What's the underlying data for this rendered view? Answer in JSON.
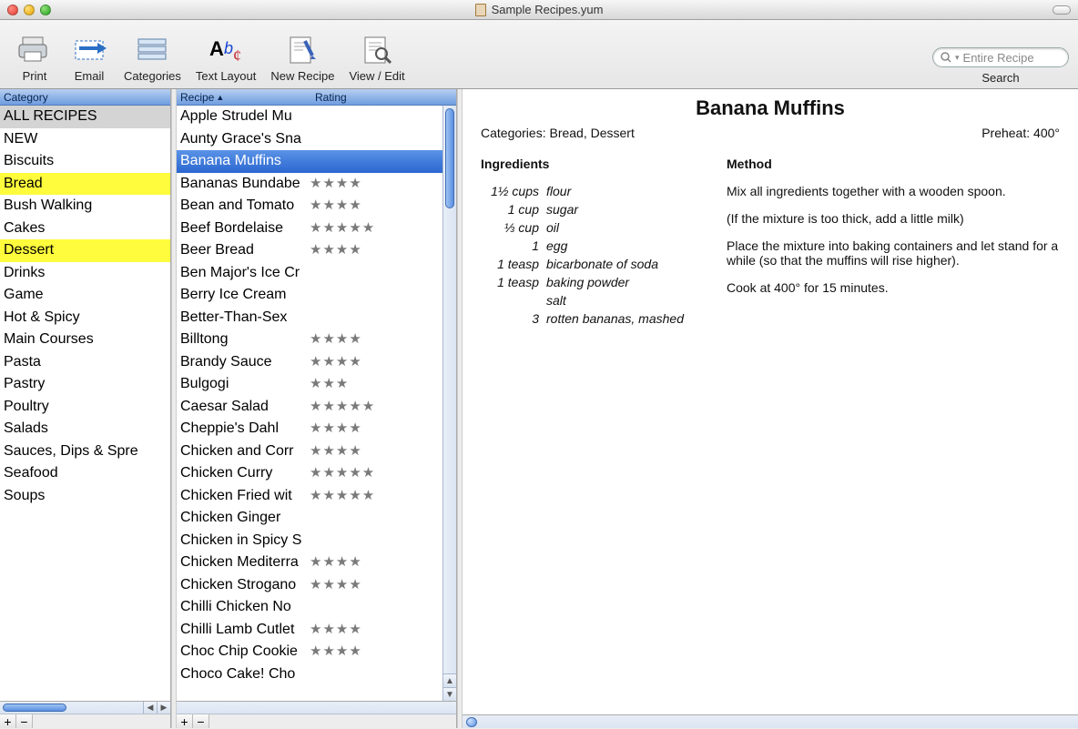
{
  "window": {
    "title": "Sample Recipes.yum"
  },
  "toolbar": {
    "items": [
      {
        "label": "Print"
      },
      {
        "label": "Email"
      },
      {
        "label": "Categories"
      },
      {
        "label": "Text Layout"
      },
      {
        "label": "New Recipe"
      },
      {
        "label": "View / Edit"
      }
    ],
    "search": {
      "placeholder": "Entire Recipe",
      "label": "Search",
      "value": ""
    }
  },
  "category_pane": {
    "header": "Category",
    "items": [
      {
        "label": "ALL RECIPES",
        "style": "allcaps"
      },
      {
        "label": " NEW"
      },
      {
        "label": "Biscuits"
      },
      {
        "label": "Bread",
        "style": "hl"
      },
      {
        "label": "Bush Walking"
      },
      {
        "label": "Cakes"
      },
      {
        "label": "Dessert",
        "style": "hl"
      },
      {
        "label": "Drinks"
      },
      {
        "label": "Game"
      },
      {
        "label": "Hot & Spicy"
      },
      {
        "label": "Main Courses"
      },
      {
        "label": "Pasta"
      },
      {
        "label": "Pastry"
      },
      {
        "label": "Poultry"
      },
      {
        "label": "Salads"
      },
      {
        "label": "Sauces, Dips & Spre"
      },
      {
        "label": "Seafood"
      },
      {
        "label": "Soups"
      }
    ]
  },
  "recipe_pane": {
    "header_recipe": "Recipe",
    "header_rating": "Rating",
    "items": [
      {
        "name": "Apple Strudel Mu",
        "stars": 0
      },
      {
        "name": "Aunty Grace's Sna",
        "stars": 0
      },
      {
        "name": "Banana Muffins",
        "stars": 0,
        "selected": true
      },
      {
        "name": "Bananas Bundabe",
        "stars": 4
      },
      {
        "name": "Bean and Tomato",
        "stars": 4
      },
      {
        "name": "Beef Bordelaise",
        "stars": 5
      },
      {
        "name": "Beer Bread",
        "stars": 4
      },
      {
        "name": "Ben Major's Ice Cr",
        "stars": 0
      },
      {
        "name": "Berry Ice Cream",
        "stars": 0
      },
      {
        "name": "Better-Than-Sex",
        "stars": 0
      },
      {
        "name": "Billtong",
        "stars": 4
      },
      {
        "name": "Brandy Sauce",
        "stars": 4
      },
      {
        "name": "Bulgogi",
        "stars": 3
      },
      {
        "name": "Caesar Salad",
        "stars": 5
      },
      {
        "name": "Cheppie's Dahl",
        "stars": 4
      },
      {
        "name": "Chicken and Corr",
        "stars": 4
      },
      {
        "name": "Chicken Curry",
        "stars": 5
      },
      {
        "name": "Chicken Fried wit",
        "stars": 5
      },
      {
        "name": "Chicken Ginger",
        "stars": 0
      },
      {
        "name": "Chicken in Spicy S",
        "stars": 0
      },
      {
        "name": "Chicken Mediterra",
        "stars": 4
      },
      {
        "name": "Chicken Strogano",
        "stars": 4
      },
      {
        "name": "Chilli Chicken No",
        "stars": 0
      },
      {
        "name": "Chilli Lamb Cutlet",
        "stars": 4
      },
      {
        "name": "Choc Chip Cookie",
        "stars": 4
      },
      {
        "name": "Choco Cake! Cho",
        "stars": 0
      }
    ]
  },
  "recipe_view": {
    "title": "Banana Muffins",
    "categories_label": "Categories:",
    "categories": "Bread, Dessert",
    "preheat_label": "Preheat:",
    "preheat": "400°",
    "ingredients_label": "Ingredients",
    "method_label": "Method",
    "ingredients": [
      {
        "qty": "1½ cups",
        "item": "flour"
      },
      {
        "qty": "1 cup",
        "item": "sugar"
      },
      {
        "qty": "⅓ cup",
        "item": "oil"
      },
      {
        "qty": "1",
        "item": "egg"
      },
      {
        "qty": "1 teasp",
        "item": "bicarbonate of soda"
      },
      {
        "qty": "1 teasp",
        "item": "baking powder"
      },
      {
        "qty": "",
        "item": "salt"
      },
      {
        "qty": "3",
        "item": "rotten bananas, mashed"
      }
    ],
    "method": [
      "Mix all ingredients together with a wooden spoon.",
      "(If the mixture is too thick, add a little milk)",
      "Place the mixture into baking containers and let stand for a while (so that the muffins will rise higher).",
      "Cook at 400° for 15 minutes."
    ]
  },
  "buttons": {
    "plus": "+",
    "minus": "−"
  }
}
